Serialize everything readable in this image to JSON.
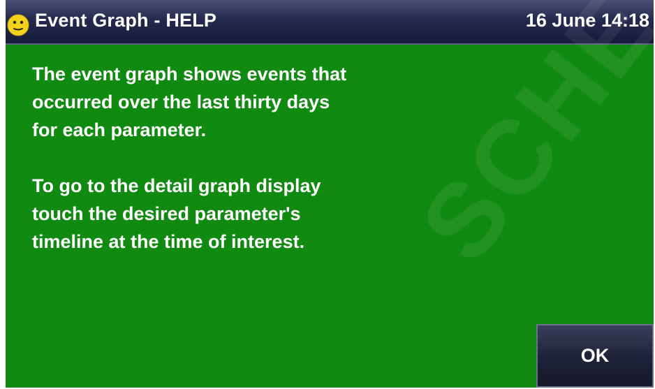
{
  "header": {
    "title": "Event Graph - HELP",
    "datetime": "16 June 14:18",
    "status_icon": "smiley-face-icon"
  },
  "help": {
    "paragraph1": "The event graph shows events that\noccurred over the last thirty days\nfor each parameter.",
    "paragraph2": "To go to the detail graph display\ntouch the desired parameter's\ntimeline at the time of interest."
  },
  "watermark": "SCHE",
  "buttons": {
    "ok_label": "OK"
  },
  "colors": {
    "background": "#118a11",
    "titlebar": "#242a4e",
    "text": "#ffffff",
    "status_icon": "#f2d21a"
  }
}
